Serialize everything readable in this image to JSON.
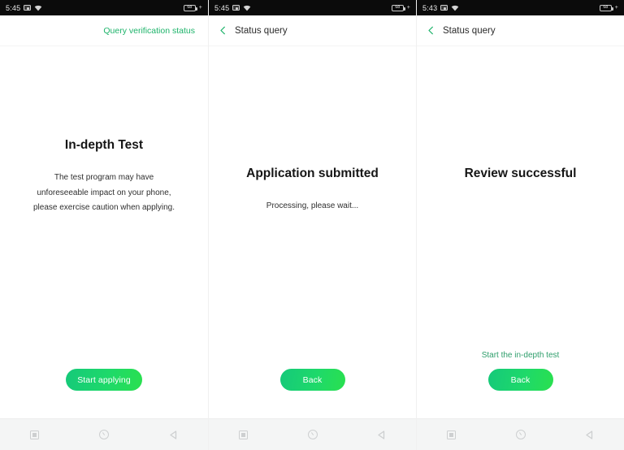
{
  "theme": {
    "accent_green": "#1db36a",
    "button_gradient_start": "#15c97a",
    "button_gradient_end": "#2ae04f",
    "statusbar_bg": "#0b0b0b",
    "navbar_bg": "#f4f5f5",
    "page_bg": "#ffffff"
  },
  "navbar": {
    "recents_label": "recents",
    "home_label": "home",
    "back_label": "back"
  },
  "screens": [
    {
      "id": "in-depth-test",
      "statusbar": {
        "time": "5:45",
        "camera_icon": "camera-icon",
        "wifi_icon": "wifi-icon",
        "battery_level": "68",
        "battery_charging": "+"
      },
      "header": {
        "type": "link-only",
        "link_label": "Query verification status"
      },
      "title": "In-depth Test",
      "description": "The test program may have unforeseeable impact on your phone, please exercise caution when applying.",
      "description_lines": [
        "The test program may have",
        "unforeseeable impact on your phone,",
        "please exercise caution when applying."
      ],
      "mid_link": "",
      "button_label": "Start applying"
    },
    {
      "id": "application-submitted",
      "statusbar": {
        "time": "5:45",
        "camera_icon": "camera-icon",
        "wifi_icon": "wifi-icon",
        "battery_level": "68",
        "battery_charging": "+"
      },
      "header": {
        "type": "back-nav",
        "back_icon": "chevron-left-icon",
        "title": "Status query"
      },
      "title": "Application submitted",
      "description": "Processing, please wait...",
      "mid_link": "",
      "button_label": "Back"
    },
    {
      "id": "review-successful",
      "statusbar": {
        "time": "5:43",
        "camera_icon": "camera-icon",
        "wifi_icon": "wifi-icon",
        "battery_level": "68",
        "battery_charging": "+"
      },
      "header": {
        "type": "back-nav",
        "back_icon": "chevron-left-icon",
        "title": "Status query"
      },
      "title": "Review successful",
      "description": "",
      "mid_link": "Start the in-depth test",
      "button_label": "Back"
    }
  ]
}
